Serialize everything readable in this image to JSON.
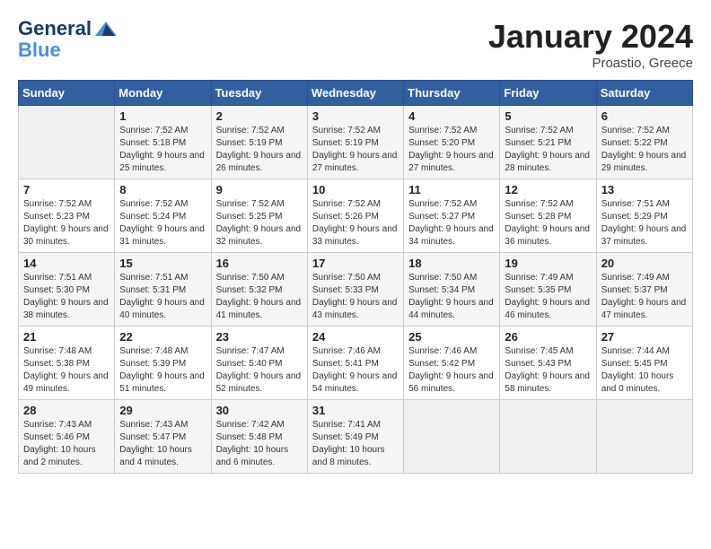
{
  "logo": {
    "line1": "General",
    "line2": "Blue"
  },
  "title": "January 2024",
  "subtitle": "Proastio, Greece",
  "days_of_week": [
    "Sunday",
    "Monday",
    "Tuesday",
    "Wednesday",
    "Thursday",
    "Friday",
    "Saturday"
  ],
  "weeks": [
    [
      {
        "day": "",
        "sunrise": "",
        "sunset": "",
        "daylight": "",
        "empty": true
      },
      {
        "day": "1",
        "sunrise": "Sunrise: 7:52 AM",
        "sunset": "Sunset: 5:18 PM",
        "daylight": "Daylight: 9 hours and 25 minutes."
      },
      {
        "day": "2",
        "sunrise": "Sunrise: 7:52 AM",
        "sunset": "Sunset: 5:19 PM",
        "daylight": "Daylight: 9 hours and 26 minutes."
      },
      {
        "day": "3",
        "sunrise": "Sunrise: 7:52 AM",
        "sunset": "Sunset: 5:19 PM",
        "daylight": "Daylight: 9 hours and 27 minutes."
      },
      {
        "day": "4",
        "sunrise": "Sunrise: 7:52 AM",
        "sunset": "Sunset: 5:20 PM",
        "daylight": "Daylight: 9 hours and 27 minutes."
      },
      {
        "day": "5",
        "sunrise": "Sunrise: 7:52 AM",
        "sunset": "Sunset: 5:21 PM",
        "daylight": "Daylight: 9 hours and 28 minutes."
      },
      {
        "day": "6",
        "sunrise": "Sunrise: 7:52 AM",
        "sunset": "Sunset: 5:22 PM",
        "daylight": "Daylight: 9 hours and 29 minutes."
      }
    ],
    [
      {
        "day": "7",
        "sunrise": "Sunrise: 7:52 AM",
        "sunset": "Sunset: 5:23 PM",
        "daylight": "Daylight: 9 hours and 30 minutes."
      },
      {
        "day": "8",
        "sunrise": "Sunrise: 7:52 AM",
        "sunset": "Sunset: 5:24 PM",
        "daylight": "Daylight: 9 hours and 31 minutes."
      },
      {
        "day": "9",
        "sunrise": "Sunrise: 7:52 AM",
        "sunset": "Sunset: 5:25 PM",
        "daylight": "Daylight: 9 hours and 32 minutes."
      },
      {
        "day": "10",
        "sunrise": "Sunrise: 7:52 AM",
        "sunset": "Sunset: 5:26 PM",
        "daylight": "Daylight: 9 hours and 33 minutes."
      },
      {
        "day": "11",
        "sunrise": "Sunrise: 7:52 AM",
        "sunset": "Sunset: 5:27 PM",
        "daylight": "Daylight: 9 hours and 34 minutes."
      },
      {
        "day": "12",
        "sunrise": "Sunrise: 7:52 AM",
        "sunset": "Sunset: 5:28 PM",
        "daylight": "Daylight: 9 hours and 36 minutes."
      },
      {
        "day": "13",
        "sunrise": "Sunrise: 7:51 AM",
        "sunset": "Sunset: 5:29 PM",
        "daylight": "Daylight: 9 hours and 37 minutes."
      }
    ],
    [
      {
        "day": "14",
        "sunrise": "Sunrise: 7:51 AM",
        "sunset": "Sunset: 5:30 PM",
        "daylight": "Daylight: 9 hours and 38 minutes."
      },
      {
        "day": "15",
        "sunrise": "Sunrise: 7:51 AM",
        "sunset": "Sunset: 5:31 PM",
        "daylight": "Daylight: 9 hours and 40 minutes."
      },
      {
        "day": "16",
        "sunrise": "Sunrise: 7:50 AM",
        "sunset": "Sunset: 5:32 PM",
        "daylight": "Daylight: 9 hours and 41 minutes."
      },
      {
        "day": "17",
        "sunrise": "Sunrise: 7:50 AM",
        "sunset": "Sunset: 5:33 PM",
        "daylight": "Daylight: 9 hours and 43 minutes."
      },
      {
        "day": "18",
        "sunrise": "Sunrise: 7:50 AM",
        "sunset": "Sunset: 5:34 PM",
        "daylight": "Daylight: 9 hours and 44 minutes."
      },
      {
        "day": "19",
        "sunrise": "Sunrise: 7:49 AM",
        "sunset": "Sunset: 5:35 PM",
        "daylight": "Daylight: 9 hours and 46 minutes."
      },
      {
        "day": "20",
        "sunrise": "Sunrise: 7:49 AM",
        "sunset": "Sunset: 5:37 PM",
        "daylight": "Daylight: 9 hours and 47 minutes."
      }
    ],
    [
      {
        "day": "21",
        "sunrise": "Sunrise: 7:48 AM",
        "sunset": "Sunset: 5:38 PM",
        "daylight": "Daylight: 9 hours and 49 minutes."
      },
      {
        "day": "22",
        "sunrise": "Sunrise: 7:48 AM",
        "sunset": "Sunset: 5:39 PM",
        "daylight": "Daylight: 9 hours and 51 minutes."
      },
      {
        "day": "23",
        "sunrise": "Sunrise: 7:47 AM",
        "sunset": "Sunset: 5:40 PM",
        "daylight": "Daylight: 9 hours and 52 minutes."
      },
      {
        "day": "24",
        "sunrise": "Sunrise: 7:46 AM",
        "sunset": "Sunset: 5:41 PM",
        "daylight": "Daylight: 9 hours and 54 minutes."
      },
      {
        "day": "25",
        "sunrise": "Sunrise: 7:46 AM",
        "sunset": "Sunset: 5:42 PM",
        "daylight": "Daylight: 9 hours and 56 minutes."
      },
      {
        "day": "26",
        "sunrise": "Sunrise: 7:45 AM",
        "sunset": "Sunset: 5:43 PM",
        "daylight": "Daylight: 9 hours and 58 minutes."
      },
      {
        "day": "27",
        "sunrise": "Sunrise: 7:44 AM",
        "sunset": "Sunset: 5:45 PM",
        "daylight": "Daylight: 10 hours and 0 minutes."
      }
    ],
    [
      {
        "day": "28",
        "sunrise": "Sunrise: 7:43 AM",
        "sunset": "Sunset: 5:46 PM",
        "daylight": "Daylight: 10 hours and 2 minutes."
      },
      {
        "day": "29",
        "sunrise": "Sunrise: 7:43 AM",
        "sunset": "Sunset: 5:47 PM",
        "daylight": "Daylight: 10 hours and 4 minutes."
      },
      {
        "day": "30",
        "sunrise": "Sunrise: 7:42 AM",
        "sunset": "Sunset: 5:48 PM",
        "daylight": "Daylight: 10 hours and 6 minutes."
      },
      {
        "day": "31",
        "sunrise": "Sunrise: 7:41 AM",
        "sunset": "Sunset: 5:49 PM",
        "daylight": "Daylight: 10 hours and 8 minutes."
      },
      {
        "day": "",
        "sunrise": "",
        "sunset": "",
        "daylight": "",
        "empty": true
      },
      {
        "day": "",
        "sunrise": "",
        "sunset": "",
        "daylight": "",
        "empty": true
      },
      {
        "day": "",
        "sunrise": "",
        "sunset": "",
        "daylight": "",
        "empty": true
      }
    ]
  ]
}
